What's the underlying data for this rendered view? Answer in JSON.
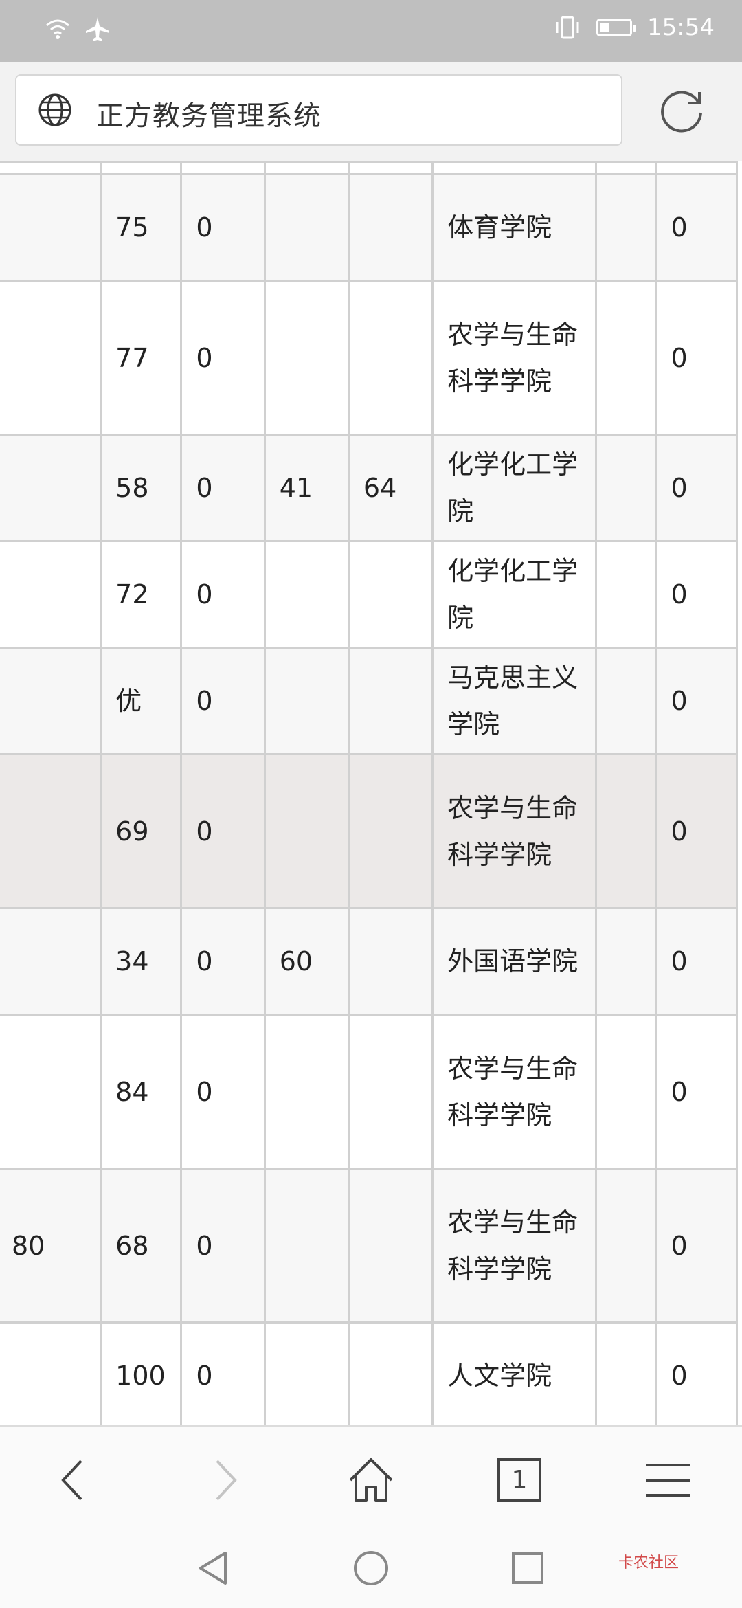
{
  "status_bar": {
    "time": "15:54",
    "icons": [
      "wifi-icon",
      "airplane-icon",
      "vibrate-icon",
      "battery-icon"
    ]
  },
  "browser": {
    "page_title": "正方教务管理系统",
    "left_icon": "globe-icon",
    "reload_icon": "reload-icon"
  },
  "table": {
    "rows": [
      {
        "c0": "",
        "c1": "",
        "c2": "",
        "c3": "",
        "c4": "",
        "c5": "",
        "c6": "",
        "c7": ""
      },
      {
        "c0": "",
        "c1": "75",
        "c2": "0",
        "c3": "",
        "c4": "",
        "c5": "体育学院",
        "c6": "",
        "c7": "0"
      },
      {
        "c0": "",
        "c1": "77",
        "c2": "0",
        "c3": "",
        "c4": "",
        "c5": "农学与生命科学学院",
        "c6": "",
        "c7": "0"
      },
      {
        "c0": "",
        "c1": "58",
        "c2": "0",
        "c3": "41",
        "c4": "64",
        "c5": "化学化工学院",
        "c6": "",
        "c7": "0"
      },
      {
        "c0": "",
        "c1": "72",
        "c2": "0",
        "c3": "",
        "c4": "",
        "c5": "化学化工学院",
        "c6": "",
        "c7": "0"
      },
      {
        "c0": "",
        "c1": "优",
        "c2": "0",
        "c3": "",
        "c4": "",
        "c5": "马克思主义学院",
        "c6": "",
        "c7": "0"
      },
      {
        "c0": "",
        "c1": "69",
        "c2": "0",
        "c3": "",
        "c4": "",
        "c5": "农学与生命科学学院",
        "c6": "",
        "c7": "0"
      },
      {
        "c0": "",
        "c1": "34",
        "c2": "0",
        "c3": "60",
        "c4": "",
        "c5": "外国语学院",
        "c6": "",
        "c7": "0"
      },
      {
        "c0": "",
        "c1": "84",
        "c2": "0",
        "c3": "",
        "c4": "",
        "c5": "农学与生命科学学院",
        "c6": "",
        "c7": "0"
      },
      {
        "c0": "80",
        "c1": "68",
        "c2": "0",
        "c3": "",
        "c4": "",
        "c5": "农学与生命科学学院",
        "c6": "",
        "c7": "0"
      },
      {
        "c0": "",
        "c1": "100",
        "c2": "0",
        "c3": "",
        "c4": "",
        "c5": "人文学院",
        "c6": "",
        "c7": "0"
      },
      {
        "c0": "",
        "c1": "",
        "c2": "",
        "c3": "",
        "c4": "",
        "c5": "",
        "c6": "",
        "c7": ""
      }
    ]
  },
  "bottom_nav": {
    "tab_count": "1",
    "icons": [
      "back-icon",
      "forward-icon",
      "home-icon",
      "tabs-icon",
      "menu-icon"
    ]
  },
  "system_nav": {
    "icons": [
      "system-back-icon",
      "system-home-icon",
      "system-recents-icon"
    ]
  },
  "watermark": "卡农社区",
  "colors": {
    "status_bar": "#bfbfbf",
    "highlight_row": "#ece9e8",
    "alt_row": "#f7f7f7",
    "grid_line": "#d0d0d0"
  }
}
